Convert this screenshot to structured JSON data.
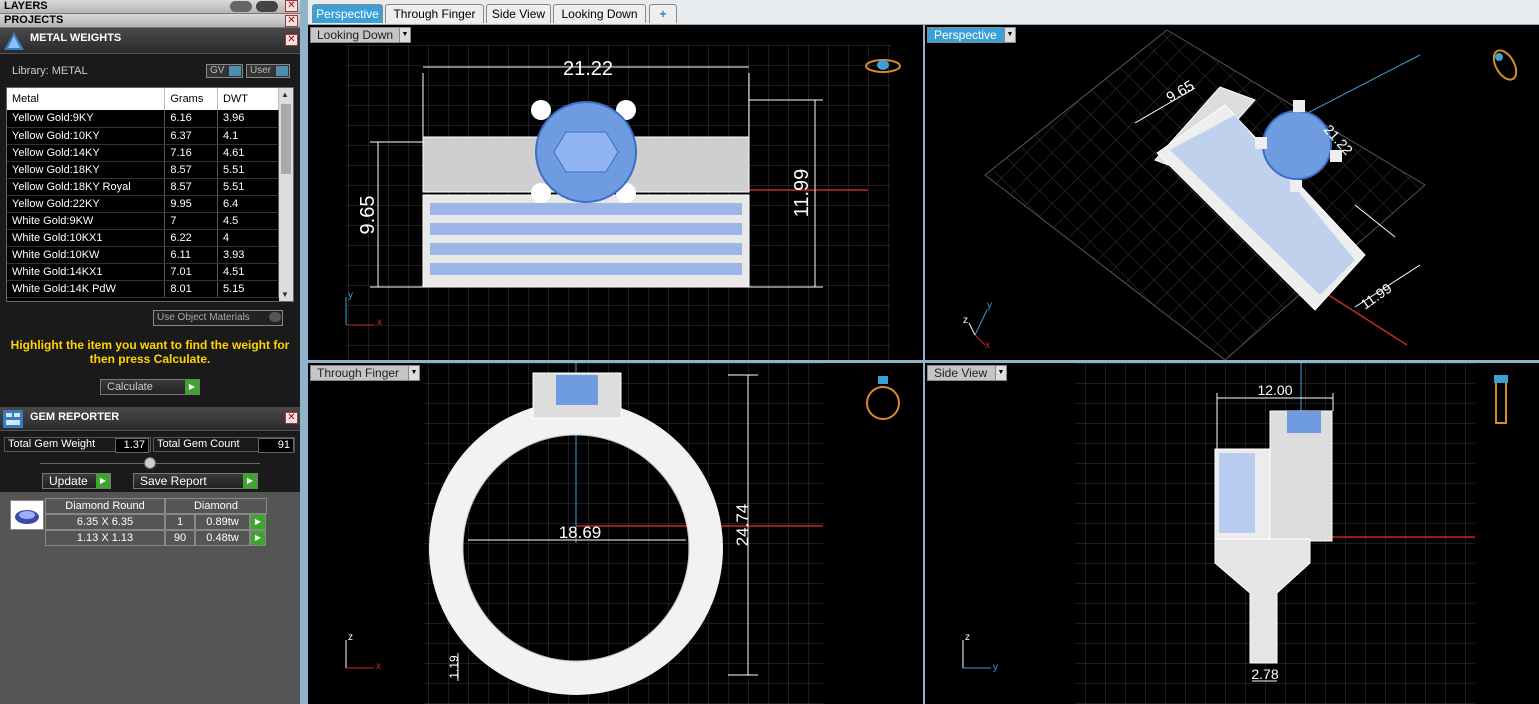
{
  "panels": {
    "layers": "LAYERS",
    "projects": "PROJECTS",
    "metal_weights": "METAL WEIGHTS",
    "gem_reporter": "GEM REPORTER"
  },
  "metal": {
    "library_label": "Library: METAL",
    "gv": "GV",
    "user": "User",
    "headers": [
      "Metal",
      "Grams",
      "DWT"
    ],
    "rows": [
      [
        "Yellow Gold:9KY",
        "6.16",
        "3.96"
      ],
      [
        "Yellow Gold:10KY",
        "6.37",
        "4.1"
      ],
      [
        "Yellow Gold:14KY",
        "7.16",
        "4.61"
      ],
      [
        "Yellow Gold:18KY",
        "8.57",
        "5.51"
      ],
      [
        "Yellow Gold:18KY Royal",
        "8.57",
        "5.51"
      ],
      [
        "Yellow Gold:22KY",
        "9.95",
        "6.4"
      ],
      [
        "White Gold:9KW",
        "7",
        "4.5"
      ],
      [
        "White Gold:10KX1",
        "6.22",
        "4"
      ],
      [
        "White Gold:10KW",
        "6.11",
        "3.93"
      ],
      [
        "White Gold:14KX1",
        "7.01",
        "4.51"
      ],
      [
        "White Gold:14K PdW",
        "8.01",
        "5.15"
      ]
    ],
    "use_object_materials": "Use Object Materials",
    "hint": "Highlight the item you want to find the weight for then press Calculate.",
    "calculate": "Calculate"
  },
  "gem": {
    "total_weight_label": "Total Gem Weight",
    "total_weight": "1.37",
    "total_count_label": "Total Gem Count",
    "total_count": "91",
    "update": "Update",
    "save_report": "Save Report",
    "shape": "Diamond Round",
    "material": "Diamond",
    "rows": [
      [
        "6.35 X 6.35",
        "1",
        "0.89tw"
      ],
      [
        "1.13 X 1.13",
        "90",
        "0.48tw"
      ]
    ]
  },
  "tabs": [
    "Perspective",
    "Through Finger",
    "Side View",
    "Looking Down",
    "+"
  ],
  "viewports": {
    "top_left": "Looking Down",
    "top_right": "Perspective",
    "bottom_left": "Through Finger",
    "bottom_right": "Side View"
  },
  "dims": {
    "ld_width": "21.22",
    "ld_left": "9.65",
    "ld_right": "11.99",
    "p_a": "9.65",
    "p_b": "21.22",
    "p_c": "11.99",
    "tf_inner": "18.69",
    "tf_height": "24.74",
    "tf_small": "1.19",
    "sv_width": "12.00",
    "sv_bottom": "2.78"
  },
  "axes": {
    "x": "x",
    "y": "y",
    "z": "z"
  },
  "colors": {
    "accent": "#3ba0d8",
    "gem": "#6f9be0",
    "highlight": "#ffd400"
  }
}
